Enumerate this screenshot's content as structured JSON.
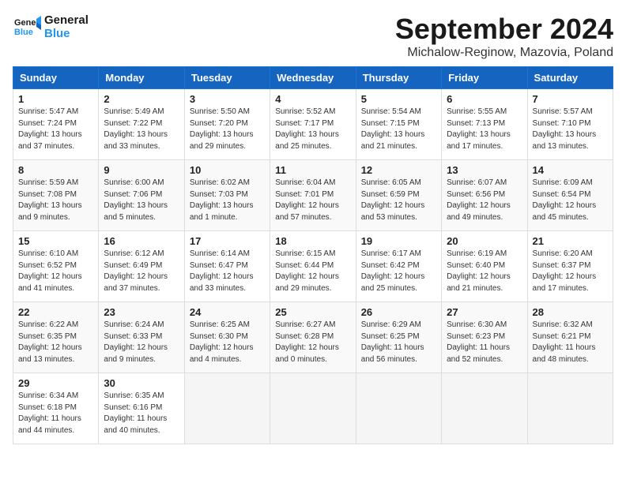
{
  "header": {
    "logo_line1": "General",
    "logo_line2": "Blue",
    "month": "September 2024",
    "location": "Michalow-Reginow, Mazovia, Poland"
  },
  "weekdays": [
    "Sunday",
    "Monday",
    "Tuesday",
    "Wednesday",
    "Thursday",
    "Friday",
    "Saturday"
  ],
  "weeks": [
    [
      {
        "day": 1,
        "info": "Sunrise: 5:47 AM\nSunset: 7:24 PM\nDaylight: 13 hours\nand 37 minutes."
      },
      {
        "day": 2,
        "info": "Sunrise: 5:49 AM\nSunset: 7:22 PM\nDaylight: 13 hours\nand 33 minutes."
      },
      {
        "day": 3,
        "info": "Sunrise: 5:50 AM\nSunset: 7:20 PM\nDaylight: 13 hours\nand 29 minutes."
      },
      {
        "day": 4,
        "info": "Sunrise: 5:52 AM\nSunset: 7:17 PM\nDaylight: 13 hours\nand 25 minutes."
      },
      {
        "day": 5,
        "info": "Sunrise: 5:54 AM\nSunset: 7:15 PM\nDaylight: 13 hours\nand 21 minutes."
      },
      {
        "day": 6,
        "info": "Sunrise: 5:55 AM\nSunset: 7:13 PM\nDaylight: 13 hours\nand 17 minutes."
      },
      {
        "day": 7,
        "info": "Sunrise: 5:57 AM\nSunset: 7:10 PM\nDaylight: 13 hours\nand 13 minutes."
      }
    ],
    [
      {
        "day": 8,
        "info": "Sunrise: 5:59 AM\nSunset: 7:08 PM\nDaylight: 13 hours\nand 9 minutes."
      },
      {
        "day": 9,
        "info": "Sunrise: 6:00 AM\nSunset: 7:06 PM\nDaylight: 13 hours\nand 5 minutes."
      },
      {
        "day": 10,
        "info": "Sunrise: 6:02 AM\nSunset: 7:03 PM\nDaylight: 13 hours\nand 1 minute."
      },
      {
        "day": 11,
        "info": "Sunrise: 6:04 AM\nSunset: 7:01 PM\nDaylight: 12 hours\nand 57 minutes."
      },
      {
        "day": 12,
        "info": "Sunrise: 6:05 AM\nSunset: 6:59 PM\nDaylight: 12 hours\nand 53 minutes."
      },
      {
        "day": 13,
        "info": "Sunrise: 6:07 AM\nSunset: 6:56 PM\nDaylight: 12 hours\nand 49 minutes."
      },
      {
        "day": 14,
        "info": "Sunrise: 6:09 AM\nSunset: 6:54 PM\nDaylight: 12 hours\nand 45 minutes."
      }
    ],
    [
      {
        "day": 15,
        "info": "Sunrise: 6:10 AM\nSunset: 6:52 PM\nDaylight: 12 hours\nand 41 minutes."
      },
      {
        "day": 16,
        "info": "Sunrise: 6:12 AM\nSunset: 6:49 PM\nDaylight: 12 hours\nand 37 minutes."
      },
      {
        "day": 17,
        "info": "Sunrise: 6:14 AM\nSunset: 6:47 PM\nDaylight: 12 hours\nand 33 minutes."
      },
      {
        "day": 18,
        "info": "Sunrise: 6:15 AM\nSunset: 6:44 PM\nDaylight: 12 hours\nand 29 minutes."
      },
      {
        "day": 19,
        "info": "Sunrise: 6:17 AM\nSunset: 6:42 PM\nDaylight: 12 hours\nand 25 minutes."
      },
      {
        "day": 20,
        "info": "Sunrise: 6:19 AM\nSunset: 6:40 PM\nDaylight: 12 hours\nand 21 minutes."
      },
      {
        "day": 21,
        "info": "Sunrise: 6:20 AM\nSunset: 6:37 PM\nDaylight: 12 hours\nand 17 minutes."
      }
    ],
    [
      {
        "day": 22,
        "info": "Sunrise: 6:22 AM\nSunset: 6:35 PM\nDaylight: 12 hours\nand 13 minutes."
      },
      {
        "day": 23,
        "info": "Sunrise: 6:24 AM\nSunset: 6:33 PM\nDaylight: 12 hours\nand 9 minutes."
      },
      {
        "day": 24,
        "info": "Sunrise: 6:25 AM\nSunset: 6:30 PM\nDaylight: 12 hours\nand 4 minutes."
      },
      {
        "day": 25,
        "info": "Sunrise: 6:27 AM\nSunset: 6:28 PM\nDaylight: 12 hours\nand 0 minutes."
      },
      {
        "day": 26,
        "info": "Sunrise: 6:29 AM\nSunset: 6:25 PM\nDaylight: 11 hours\nand 56 minutes."
      },
      {
        "day": 27,
        "info": "Sunrise: 6:30 AM\nSunset: 6:23 PM\nDaylight: 11 hours\nand 52 minutes."
      },
      {
        "day": 28,
        "info": "Sunrise: 6:32 AM\nSunset: 6:21 PM\nDaylight: 11 hours\nand 48 minutes."
      }
    ],
    [
      {
        "day": 29,
        "info": "Sunrise: 6:34 AM\nSunset: 6:18 PM\nDaylight: 11 hours\nand 44 minutes."
      },
      {
        "day": 30,
        "info": "Sunrise: 6:35 AM\nSunset: 6:16 PM\nDaylight: 11 hours\nand 40 minutes."
      },
      null,
      null,
      null,
      null,
      null
    ]
  ]
}
